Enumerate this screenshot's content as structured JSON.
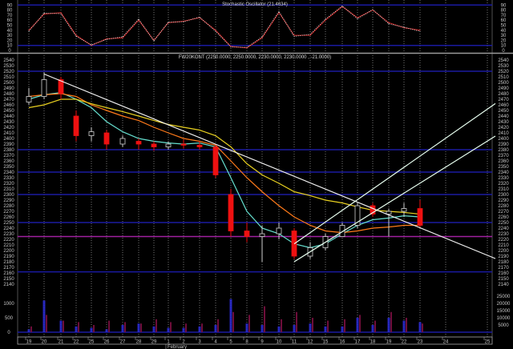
{
  "chart_data": [
    {
      "type": "line",
      "title": "Stochastic Oscillator (21.4634)",
      "ylim": [
        0,
        90
      ],
      "y_ticks": [
        0,
        10,
        20,
        30,
        40,
        50,
        60,
        70,
        80,
        90
      ],
      "reference_levels": [
        10,
        90
      ],
      "dates": [
        "Jan 19",
        "Jan 20",
        "Jan 21",
        "Jan 22",
        "Jan 25",
        "Jan 26",
        "Jan 27",
        "Jan 28",
        "Jan 29",
        "Feb 1",
        "Feb 2",
        "Feb 3",
        "Feb 4",
        "Feb 5",
        "Feb 8",
        "Feb 9",
        "Feb 10",
        "Feb 11",
        "Feb 12",
        "Feb 15",
        "Feb 16",
        "Feb 17",
        "Feb 18",
        "Feb 19",
        "Feb 22",
        "Feb 23"
      ],
      "series": [
        {
          "values": [
            40,
            72,
            75,
            30,
            10,
            23,
            25,
            60,
            20,
            55,
            58,
            65,
            40,
            8,
            5,
            25,
            75,
            30,
            30,
            60,
            87,
            65,
            80,
            55,
            45,
            40
          ],
          "color": "#cc2222"
        },
        {
          "values": [
            38,
            74,
            73,
            28,
            11,
            22,
            27,
            62,
            19,
            56,
            57,
            66,
            38,
            7,
            6,
            27,
            77,
            28,
            32,
            62,
            88,
            63,
            81,
            53,
            46,
            38
          ],
          "color": "#e0e0e0"
        }
      ]
    },
    {
      "type": "candlestick",
      "title": "FW20KONT (2250.0000, 2250.0000, 2230.0000, 2230.0000 , -21.0000)",
      "ylim": [
        2140,
        2540
      ],
      "y_tick_step": 10,
      "candles": [
        {
          "o": 2465,
          "h": 2490,
          "l": 2460,
          "c": 2475
        },
        {
          "o": 2475,
          "h": 2518,
          "l": 2470,
          "c": 2505
        },
        {
          "o": 2505,
          "h": 2510,
          "l": 2470,
          "c": 2480
        },
        {
          "o": 2440,
          "h": 2450,
          "l": 2395,
          "c": 2405
        },
        {
          "o": 2405,
          "h": 2420,
          "l": 2395,
          "c": 2412
        },
        {
          "o": 2410,
          "h": 2415,
          "l": 2380,
          "c": 2390
        },
        {
          "o": 2390,
          "h": 2405,
          "l": 2385,
          "c": 2400
        },
        {
          "o": 2395,
          "h": 2400,
          "l": 2380,
          "c": 2390
        },
        {
          "o": 2390,
          "h": 2395,
          "l": 2378,
          "c": 2385
        },
        {
          "o": 2385,
          "h": 2395,
          "l": 2380,
          "c": 2390
        },
        {
          "o": 2390,
          "h": 2398,
          "l": 2382,
          "c": 2388
        },
        {
          "o": 2388,
          "h": 2395,
          "l": 2380,
          "c": 2385
        },
        {
          "o": 2385,
          "h": 2390,
          "l": 2330,
          "c": 2335
        },
        {
          "o": 2300,
          "h": 2310,
          "l": 2225,
          "c": 2235
        },
        {
          "o": 2235,
          "h": 2250,
          "l": 2215,
          "c": 2225
        },
        {
          "o": 2225,
          "h": 2245,
          "l": 2180,
          "c": 2230
        },
        {
          "o": 2230,
          "h": 2250,
          "l": 2220,
          "c": 2240
        },
        {
          "o": 2235,
          "h": 2240,
          "l": 2185,
          "c": 2190
        },
        {
          "o": 2190,
          "h": 2215,
          "l": 2185,
          "c": 2205
        },
        {
          "o": 2205,
          "h": 2230,
          "l": 2200,
          "c": 2225
        },
        {
          "o": 2225,
          "h": 2250,
          "l": 2225,
          "c": 2245
        },
        {
          "o": 2245,
          "h": 2285,
          "l": 2240,
          "c": 2280
        },
        {
          "o": 2280,
          "h": 2285,
          "l": 2260,
          "c": 2265
        },
        {
          "o": 2265,
          "h": 2275,
          "l": 2225,
          "c": 2270
        },
        {
          "o": 2270,
          "h": 2285,
          "l": 2260,
          "c": 2275
        },
        {
          "o": 2275,
          "h": 2290,
          "l": 2240,
          "c": 2245
        }
      ],
      "up_color": "#d0d0d0",
      "down_color": "#ee1111",
      "moving_averages": [
        {
          "color": "#66e0d0",
          "values": [
            2470,
            2478,
            2482,
            2470,
            2455,
            2430,
            2412,
            2400,
            2395,
            2392,
            2390,
            2392,
            2385,
            2330,
            2270,
            2240,
            2230,
            2212,
            2205,
            2212,
            2230,
            2245,
            2255,
            2258,
            2262,
            2260
          ]
        },
        {
          "color": "#ff7a1a",
          "values": [
            2475,
            2478,
            2480,
            2475,
            2460,
            2450,
            2440,
            2432,
            2420,
            2410,
            2400,
            2395,
            2388,
            2360,
            2330,
            2305,
            2280,
            2260,
            2245,
            2235,
            2232,
            2235,
            2240,
            2242,
            2245,
            2245
          ]
        },
        {
          "color": "#e8d020",
          "values": [
            2455,
            2460,
            2470,
            2470,
            2462,
            2455,
            2448,
            2440,
            2432,
            2425,
            2420,
            2415,
            2405,
            2385,
            2355,
            2335,
            2320,
            2305,
            2298,
            2290,
            2285,
            2278,
            2272,
            2270,
            2268,
            2265
          ]
        }
      ],
      "trendlines": [
        {
          "from": {
            "date": "Jan 20",
            "price": 2515
          },
          "to": {
            "date": "Feb 25",
            "price": 2190
          },
          "color": "#f0f0f0"
        },
        {
          "from": {
            "date": "Feb 11",
            "price": 2180
          },
          "to": {
            "date": "Feb 25",
            "price": 2400
          },
          "color": "#e8fff0"
        },
        {
          "from": {
            "date": "Feb 11",
            "price": 2212
          },
          "to": {
            "date": "Feb 25",
            "price": 2458
          },
          "color": "#e8fff0"
        }
      ],
      "horizontal_levels": [
        {
          "price": 2520,
          "color": "#1a1aa0"
        },
        {
          "price": 2380,
          "color": "#1a1aa0"
        },
        {
          "price": 2340,
          "color": "#1a1aa0"
        },
        {
          "price": 2300,
          "color": "#1a1aa0"
        },
        {
          "price": 2250,
          "color": "#1a1aa0"
        },
        {
          "price": 2162,
          "color": "#1a1aa0"
        },
        {
          "price": 2225,
          "color": "#a020a0"
        }
      ]
    },
    {
      "type": "bar",
      "left_y_ticks": [
        0,
        500,
        1000
      ],
      "right_y_ticks": [
        5000,
        10000,
        15000,
        20000,
        25000
      ],
      "series": [
        {
          "axis": "right",
          "color": "#7a1040",
          "values": [
            4000,
            12000,
            8000,
            7000,
            5000,
            8000,
            7000,
            6000,
            9000,
            7000,
            6000,
            6000,
            9000,
            14000,
            12000,
            18000,
            9000,
            14000,
            10000,
            8000,
            9000,
            12000,
            8000,
            14000,
            10000,
            6000
          ]
        },
        {
          "axis": "left",
          "color": "#2a2ad0",
          "values": [
            100,
            1100,
            400,
            200,
            150,
            100,
            250,
            300,
            200,
            150,
            150,
            200,
            250,
            1150,
            300,
            250,
            200,
            250,
            300,
            200,
            200,
            500,
            250,
            500,
            400,
            350
          ]
        }
      ]
    }
  ],
  "x_axis": {
    "tick_labels": [
      "19",
      "20",
      "21",
      "22",
      "25",
      "26",
      "27",
      "28",
      "29",
      "1",
      "2",
      "3",
      "4",
      "5",
      "8",
      "9",
      "10",
      "11",
      "12",
      "15",
      "16",
      "17",
      "18",
      "19",
      "22",
      "23",
      "24",
      "25"
    ],
    "tick_dates": [
      "Jan 19",
      "Jan 20",
      "Jan 21",
      "Jan 22",
      "Jan 25",
      "Jan 26",
      "Jan 27",
      "Jan 28",
      "Jan 29",
      "Feb 1",
      "Feb 2",
      "Feb 3",
      "Feb 4",
      "Feb 5",
      "Feb 8",
      "Feb 9",
      "Feb 10",
      "Feb 11",
      "Feb 12",
      "Feb 15",
      "Feb 16",
      "Feb 17",
      "Feb 18",
      "Feb 19",
      "Feb 22",
      "Feb 23",
      "Feb 24",
      "Feb 25"
    ],
    "month_label": "February"
  }
}
